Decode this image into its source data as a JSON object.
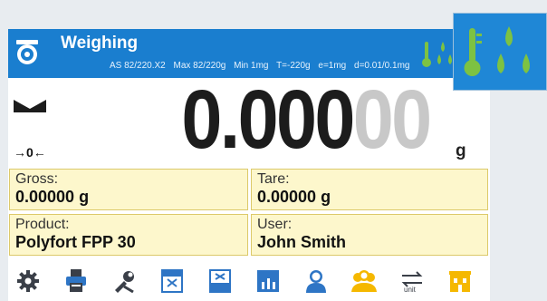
{
  "header": {
    "title": "Weighing",
    "specs": [
      "AS 82/220.X2",
      "Max 82/220g",
      "Min 1mg",
      "T=-220g",
      "e=1mg",
      "d=0.01/0.1mg"
    ],
    "icons": [
      "thermometer-icon",
      "humidity-drops-icon"
    ]
  },
  "display": {
    "reading_main": "0.000",
    "reading_faded": "00",
    "unit": "g",
    "stable_indicator": "stable-icon",
    "zero_indicator": "→0←"
  },
  "fields": {
    "gross": {
      "label": "Gross:",
      "value": "0.00000 g"
    },
    "tare": {
      "label": "Tare:",
      "value": "0.00000 g"
    },
    "product": {
      "label": "Product:",
      "value": "Polyfort FPP 30"
    },
    "user": {
      "label": "User:",
      "value": "John Smith"
    }
  },
  "footer_buttons": [
    "settings-gear-icon",
    "printer-icon",
    "tools-icon",
    "header-printout-icon",
    "footer-printout-icon",
    "statistics-icon",
    "user-icon",
    "users-icon",
    "unit-change-icon",
    "warehouse-icon"
  ],
  "popup": {
    "icons": [
      "thermometer-icon",
      "humidity-drops-icon"
    ]
  },
  "colors": {
    "header_bg": "#1a7ecf",
    "field_bg": "#fdf7cc",
    "accent_green": "#7dc242",
    "accent_yellow": "#f5b800",
    "icon_blue": "#2e75c5"
  }
}
